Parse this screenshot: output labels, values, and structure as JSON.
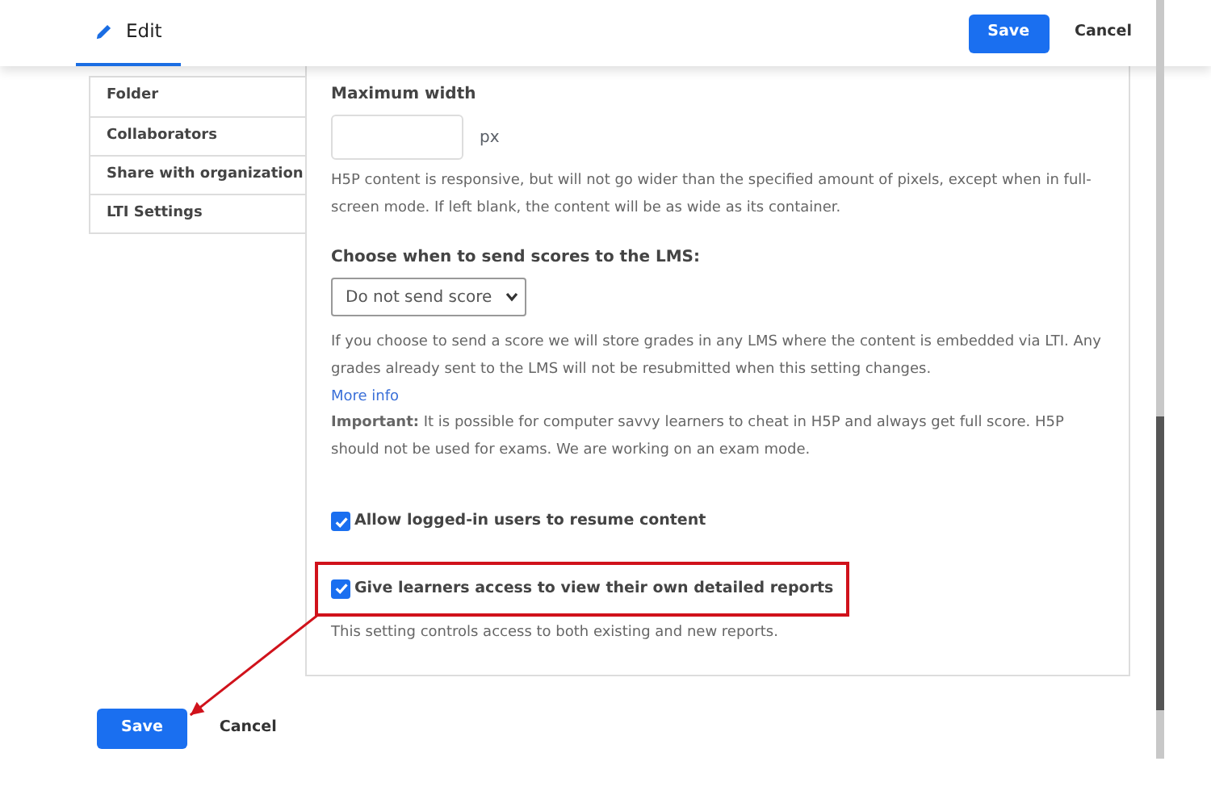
{
  "header": {
    "tab": {
      "label": "Edit",
      "selected": true
    },
    "save": "Save",
    "cancel": "Cancel"
  },
  "sidebar": {
    "items": [
      {
        "label": "Folder"
      },
      {
        "label": "Collaborators"
      },
      {
        "label": "Share with organization"
      },
      {
        "label": "LTI Settings"
      }
    ]
  },
  "max_width": {
    "label": "Maximum width",
    "unit": "px",
    "help": "H5P content is responsive, but will not go wider than the specified amount of pixels, except when in full-screen mode. If left blank, the content will be as wide as its container."
  },
  "scores": {
    "label": "Choose when to send scores to the LMS:",
    "value": "Do not send score",
    "help": "If you choose to send a score we will store grades in any LMS where the content is embedded via LTI. Any grades already sent to the LMS will not be resubmitted when this setting changes.",
    "link": "More info",
    "important": "**Important:** It is possible for computer savvy learners to cheat in H5P and always get full score. H5P should not be used for exams. We are working on an exam mode."
  },
  "options": [
    {
      "label": "Allow logged-in users to resume content",
      "checked": true,
      "highlighted": false
    },
    {
      "label": "Give learners access to view their own detailed reports",
      "checked": true,
      "highlighted": true,
      "note": "This setting controls access to both existing and new reports."
    }
  ],
  "footer": {
    "save": "Save",
    "cancel": "Cancel"
  }
}
